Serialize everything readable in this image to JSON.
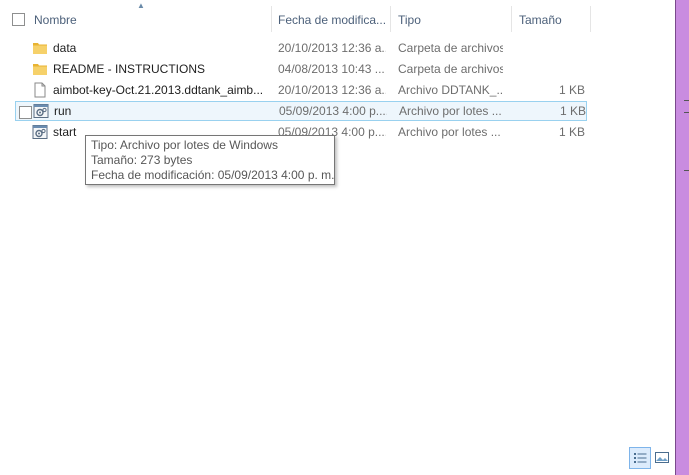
{
  "columns": {
    "name": "Nombre",
    "date": "Fecha de modifica...",
    "type": "Tipo",
    "size": "Tamaño"
  },
  "files": [
    {
      "name": "data",
      "date": "20/10/2013 12:36 a...",
      "type": "Carpeta de archivos",
      "size": "",
      "icon": "folder-icon"
    },
    {
      "name": "README - INSTRUCTIONS",
      "date": "04/08/2013 10:43 ...",
      "type": "Carpeta de archivos",
      "size": "",
      "icon": "folder-icon"
    },
    {
      "name": "aimbot-key-Oct.21.2013.ddtank_aimb...",
      "date": "20/10/2013 12:36 a...",
      "type": "Archivo DDTANK_...",
      "size": "1 KB",
      "icon": "file-icon"
    },
    {
      "name": "run",
      "date": "05/09/2013 4:00 p....",
      "type": "Archivo por lotes ...",
      "size": "1 KB",
      "icon": "batch-file-icon"
    },
    {
      "name": "start",
      "date": "05/09/2013 4:00 p....",
      "type": "Archivo por lotes ...",
      "size": "1 KB",
      "icon": "batch-file-icon"
    }
  ],
  "tooltip": {
    "type_line": "Tipo: Archivo por lotes de Windows",
    "size_line": "Tamaño: 273 bytes",
    "date_line": "Fecha de modificación: 05/09/2013 4:00 p. m."
  },
  "colors": {
    "selection_bg": "#eef6fc",
    "selection_border": "#99d1ef",
    "header_text": "#4c607a",
    "window_border": "#c98ce0"
  }
}
